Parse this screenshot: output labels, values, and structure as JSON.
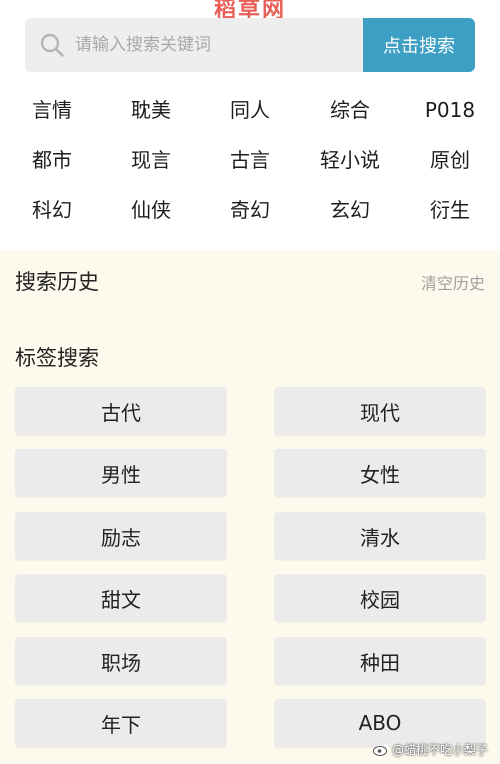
{
  "watermark_top": "稻草网",
  "search": {
    "placeholder": "请输入搜索关键词",
    "button_label": "点击搜索"
  },
  "categories": [
    [
      "言情",
      "耽美",
      "同人",
      "综合",
      "P018"
    ],
    [
      "都市",
      "现言",
      "古言",
      "轻小说",
      "原创"
    ],
    [
      "科幻",
      "仙侠",
      "奇幻",
      "玄幻",
      "衍生"
    ]
  ],
  "history": {
    "title": "搜索历史",
    "clear_label": "清空历史"
  },
  "tags": {
    "title": "标签搜索",
    "items": [
      "古代",
      "现代",
      "男性",
      "女性",
      "励志",
      "清水",
      "甜文",
      "校园",
      "职场",
      "种田",
      "年下",
      "ABO"
    ]
  },
  "watermark_bottom": "@蜡桃不吃小梨子",
  "colors": {
    "accent": "#3d9fc4",
    "background": "#fdf9ec",
    "tag_bg": "#ebebeb"
  }
}
